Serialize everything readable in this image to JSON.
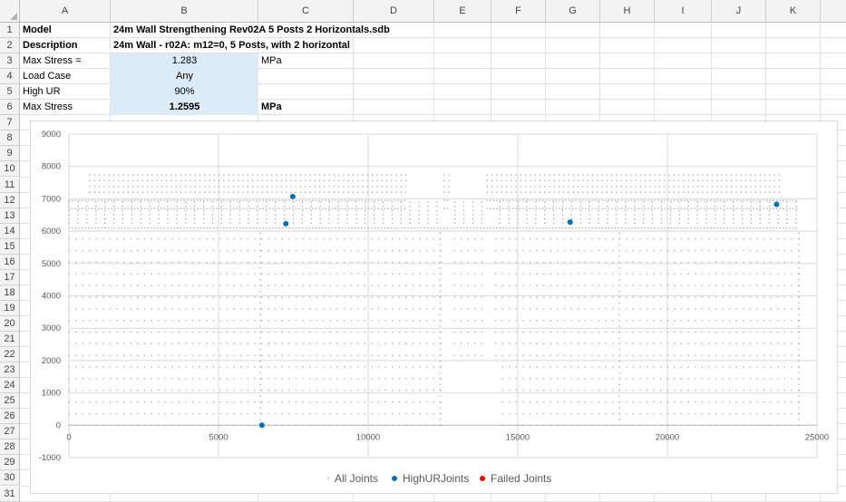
{
  "sheet": {
    "columns": [
      "A",
      "B",
      "C",
      "D",
      "E",
      "F",
      "G",
      "H",
      "I",
      "J",
      "K"
    ],
    "rows": [
      "1",
      "2",
      "3",
      "4",
      "5",
      "6",
      "7",
      "8",
      "9",
      "10",
      "11",
      "12",
      "13",
      "14",
      "15",
      "16",
      "17",
      "18",
      "19",
      "20",
      "21",
      "22",
      "23",
      "24",
      "25",
      "26",
      "27",
      "28",
      "29",
      "30",
      "31"
    ]
  },
  "cells": {
    "model_label": "Model",
    "model_value": "24m Wall Strengthening Rev02A 5 Posts 2 Horizontals.sdb",
    "description_label": "Description",
    "description_value": "24m Wall - r02A: m12=0, 5 Posts, with 2 horizontal",
    "max_stress_label": "Max Stress =",
    "max_stress_value": "1.283",
    "max_stress_unit": "MPa",
    "load_case_label": "Load Case",
    "load_case_value": "Any",
    "high_ur_label": "High UR",
    "high_ur_value": "90%",
    "max_stress2_label": "Max Stress",
    "max_stress2_value": "1.2595",
    "max_stress2_unit": "MPa"
  },
  "colors": {
    "all_joints": "#a6a6a6",
    "high_ur_joints": "#0070c0",
    "failed_joints": "#ff0000",
    "input_fill": "#ddebf7"
  },
  "chart_data": {
    "type": "scatter",
    "xlim": [
      0,
      25000
    ],
    "ylim": [
      -1000,
      9000
    ],
    "x_ticks": [
      "0",
      "5000",
      "10000",
      "15000",
      "20000",
      "25000"
    ],
    "y_ticks": [
      "9000",
      "8000",
      "7000",
      "6000",
      "5000",
      "4000",
      "3000",
      "2000",
      "1000",
      "0",
      "-1000"
    ],
    "grid": true,
    "legend": "bottom",
    "series": [
      {
        "name": "All Joints",
        "marker": "dot",
        "color": "#a6a6a6"
      },
      {
        "name": "HighURJoints",
        "marker": "circle",
        "color": "#0070c0",
        "points": [
          [
            6450,
            0
          ],
          [
            7250,
            6230
          ],
          [
            7480,
            7070
          ],
          [
            16750,
            6280
          ],
          [
            23650,
            6830
          ]
        ]
      },
      {
        "name": "Failed Joints",
        "marker": "circle",
        "color": "#ff0000",
        "points": []
      }
    ]
  }
}
